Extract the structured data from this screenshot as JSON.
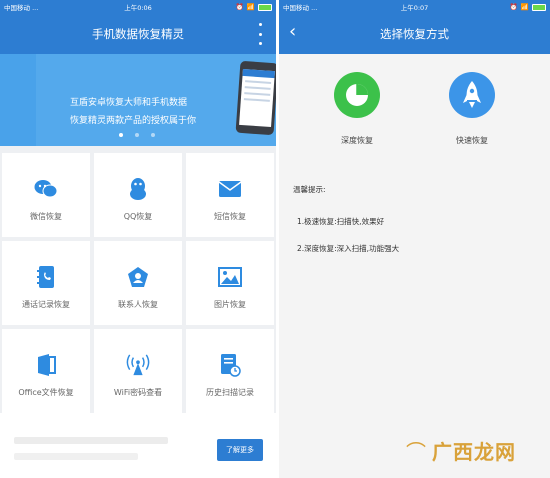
{
  "left_screen": {
    "status": {
      "carrier": "中国移动 ...",
      "time": "上午0:06"
    },
    "title": "手机数据恢复精灵",
    "banner": {
      "line1": "互盾安卓恢复大师和手机数据",
      "line2": "恢复精灵两款产品的授权属于你",
      "dot_count": 3,
      "active_dot": 1
    },
    "grid": [
      {
        "label": "微信恢复",
        "icon": "wechat-icon"
      },
      {
        "label": "QQ恢复",
        "icon": "qq-icon"
      },
      {
        "label": "短信恢复",
        "icon": "message-icon"
      },
      {
        "label": "通话记录恢复",
        "icon": "call-log-icon"
      },
      {
        "label": "联系人恢复",
        "icon": "contact-icon"
      },
      {
        "label": "图片恢复",
        "icon": "image-icon"
      },
      {
        "label": "Office文件恢复",
        "icon": "office-icon"
      },
      {
        "label": "WiFi密码查看",
        "icon": "wifi-icon"
      },
      {
        "label": "历史扫描记录",
        "icon": "history-icon"
      }
    ],
    "more_button": "了解更多"
  },
  "right_screen": {
    "status": {
      "carrier": "中国移动 ...",
      "time": "上午0:07"
    },
    "title": "选择恢复方式",
    "modes": [
      {
        "label": "深度恢复",
        "icon": "pie-chart-icon",
        "color": "#3cc14a"
      },
      {
        "label": "快速恢复",
        "icon": "rocket-icon",
        "color": "#3c95e8"
      }
    ],
    "tips_title": "温馨提示:",
    "tips": [
      "1.极速恢复:扫描快,效果好",
      "2.深度恢复:深入扫描,功能强大"
    ]
  },
  "watermark": "广西龙网",
  "colors": {
    "primary": "#2d7dd2",
    "banner": "#54a9ec",
    "grid_icon": "#2e8be0",
    "green": "#3cc14a",
    "battery": "#6bd84a"
  }
}
